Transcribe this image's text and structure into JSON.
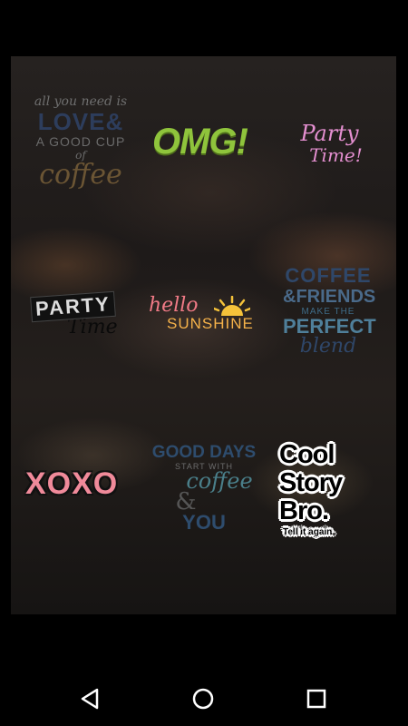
{
  "stickers": {
    "love": {
      "line1": "all you need is",
      "line2": "LOVE&",
      "line3": "A GOOD CUP",
      "line4": "of",
      "line5": "coffee"
    },
    "omg": {
      "text": "OMG!"
    },
    "party_pink": {
      "line1": "Party",
      "line2": "Time!"
    },
    "party_black": {
      "line1": "PARTY",
      "line2": "Time"
    },
    "hello_sunshine": {
      "line1": "hello",
      "line2": "SUNSHINE"
    },
    "coffee_friends": {
      "line1": "COFFEE",
      "line2": "&FRIENDS",
      "line3": "MAKE THE",
      "line4": "PERFECT",
      "line5": "blend"
    },
    "xoxo": {
      "text": "XOXO"
    },
    "good_days": {
      "line1": "GOOD DAYS",
      "line2": "START WITH",
      "line3": "coffee",
      "line4": "&",
      "line5": "YOU"
    },
    "cool_story": {
      "line1": "Cool",
      "line2": "Story",
      "line3": "Bro.",
      "line4": "Tell it again."
    }
  },
  "navbar": {
    "icons": [
      "back-icon",
      "home-icon",
      "recents-icon"
    ]
  },
  "colors": {
    "background": "#000000",
    "accent_green": "#8fc43c",
    "accent_pink": "#f08a9a"
  }
}
